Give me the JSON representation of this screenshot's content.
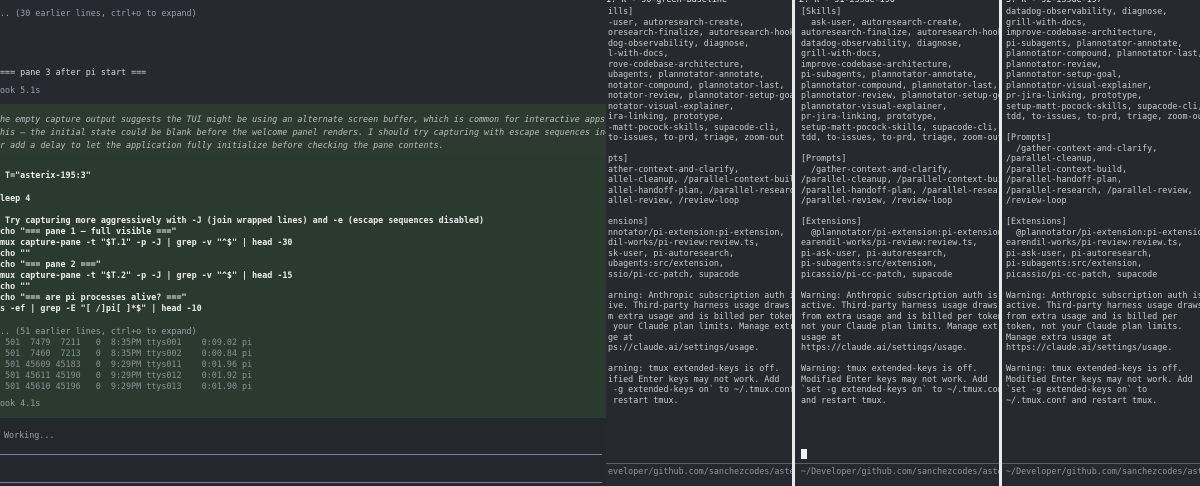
{
  "left": {
    "earlier_lines": ".. (30 earlier lines, ctrl+o to expand)",
    "pane3_after": "=== pane 3 after pi start ===",
    "took1": "ook 5.1s",
    "think1": "he empty capture output suggests the TUI might be using an alternate screen buffer, which is common for interactive apps like",
    "think2": "his — the initial state could be blank before the welcome panel renders. I should try capturing with escape sequences included",
    "think3": "r add a delay to let the application fully initialize before checking the pane contents.",
    "cmd_t": " T=\"asterix-195:3\"",
    "cmd_sleep": "leep 4",
    "cmd_comment": " Try capturing more aggressively with -J (join wrapped lines) and -e (escape sequences disabled)",
    "cmd1": "cho \"=== pane 1 — full visible ===\"",
    "cmd2": "mux capture-pane -t \"$T.1\" -p -J | grep -v \"^$\" | head -30",
    "cmd3": "cho \"\"",
    "cmd4": "cho \"=== pane 2 ===\"",
    "cmd5": "mux capture-pane -t \"$T.2\" -p -J | grep -v \"^$\" | head -15",
    "cmd6": "cho \"\"",
    "cmd7": "cho \"=== are pi processes alive? ===\"",
    "cmd8": "s -ef | grep -E \"[ /]pi[ ]*$\" | head -10",
    "earlier51": ".. (51 earlier lines, ctrl+o to expand)",
    "proc": [
      " 501  7479  7211   0  8:35PM ttys001    0:09.02 pi",
      " 501  7460  7213   0  8:35PM ttys002    0:00.84 pi",
      " 501 45609 45183   0  9:29PM ttys011    0:01.96 pi",
      " 501 45611 45190   0  9:29PM ttys012    0:01.92 pi",
      " 501 45610 45196   0  9:29PM ttys013    0:01.90 pi"
    ],
    "took2": "ook 4.1s",
    "working": "Working..."
  },
  "panes": [
    {
      "title": "1: π - s0-green-baseline",
      "lines": [
        {
          "t": "ills]",
          "c": "hdr"
        },
        {
          "t": "-user, autoresearch-create,",
          "c": ""
        },
        {
          "t": "oresearch-finalize, autoresearch-hooks,",
          "c": ""
        },
        {
          "t": "dog-observability, diagnose,",
          "c": ""
        },
        {
          "t": "l-with-docs,",
          "c": ""
        },
        {
          "t": "rove-codebase-architecture,",
          "c": ""
        },
        {
          "t": "ubagents, plannotator-annotate,",
          "c": ""
        },
        {
          "t": "notator-compound, plannotator-last,",
          "c": ""
        },
        {
          "t": "notator-review, plannotator-setup-goal,",
          "c": ""
        },
        {
          "t": "notator-visual-explainer,",
          "c": ""
        },
        {
          "t": "ira-linking, prototype,",
          "c": ""
        },
        {
          "t": "-matt-pocock-skills, supacode-cli,",
          "c": ""
        },
        {
          "t": "to-issues, to-prd, triage, zoom-out",
          "c": ""
        },
        {
          "t": "",
          "c": ""
        },
        {
          "t": "pts]",
          "c": "hdr"
        },
        {
          "t": "ather-context-and-clarify,",
          "c": ""
        },
        {
          "t": "allel-cleanup, /parallel-context-build,",
          "c": ""
        },
        {
          "t": "allel-handoff-plan, /parallel-research,",
          "c": ""
        },
        {
          "t": "allel-review, /review-loop",
          "c": ""
        },
        {
          "t": "",
          "c": ""
        },
        {
          "t": "ensions]",
          "c": "hdr"
        },
        {
          "t": "nnotator/pi-extension:pi-extension,",
          "c": ""
        },
        {
          "t": "dil-works/pi-review:review.ts,",
          "c": ""
        },
        {
          "t": "sk-user, pi-autoresearch,",
          "c": ""
        },
        {
          "t": "ubagents:src/extension,",
          "c": ""
        },
        {
          "t": "ssio/pi-cc-patch, supacode",
          "c": ""
        },
        {
          "t": "",
          "c": ""
        },
        {
          "t": "arning: Anthropic subscription auth is",
          "c": "warn"
        },
        {
          "t": "ive. Third-party harness usage draws",
          "c": "warn"
        },
        {
          "t": "m extra usage and is billed per token,",
          "c": "warn"
        },
        {
          "t": " your Claude plan limits. Manage extra",
          "c": "warn"
        },
        {
          "t": "ge at",
          "c": "warn"
        },
        {
          "t": "ps://claude.ai/settings/usage.",
          "c": "warn"
        },
        {
          "t": "",
          "c": ""
        },
        {
          "t": "arning: tmux extended-keys is off.",
          "c": "warn"
        },
        {
          "t": "ified Enter keys may not work. Add",
          "c": "warn"
        },
        {
          "t": " -g extended-keys on` to ~/.tmux.conf",
          "c": "warn"
        },
        {
          "t": " restart tmux.",
          "c": "warn"
        }
      ],
      "status1": "eveloper/github.com/sanchezcodes/aste...",
      "status2": "",
      "show_cursor": false
    },
    {
      "title": "2: π - s1-issue-196",
      "lines": [
        {
          "t": "[Skills]",
          "c": "hdr"
        },
        {
          "t": "  ask-user, autoresearch-create,",
          "c": ""
        },
        {
          "t": "autoresearch-finalize, autoresearch-hooks,",
          "c": ""
        },
        {
          "t": "datadog-observability, diagnose,",
          "c": ""
        },
        {
          "t": "grill-with-docs,",
          "c": ""
        },
        {
          "t": "improve-codebase-architecture,",
          "c": ""
        },
        {
          "t": "pi-subagents, plannotator-annotate,",
          "c": ""
        },
        {
          "t": "plannotator-compound, plannotator-last,",
          "c": ""
        },
        {
          "t": "plannotator-review, plannotator-setup-goal,",
          "c": ""
        },
        {
          "t": "plannotator-visual-explainer,",
          "c": ""
        },
        {
          "t": "pr-jira-linking, prototype,",
          "c": ""
        },
        {
          "t": "setup-matt-pocock-skills, supacode-cli,",
          "c": ""
        },
        {
          "t": "tdd, to-issues, to-prd, triage, zoom-out",
          "c": ""
        },
        {
          "t": "",
          "c": ""
        },
        {
          "t": "[Prompts]",
          "c": "hdr"
        },
        {
          "t": "  /gather-context-and-clarify,",
          "c": ""
        },
        {
          "t": "/parallel-cleanup, /parallel-context-build,",
          "c": ""
        },
        {
          "t": "/parallel-handoff-plan, /parallel-research,",
          "c": ""
        },
        {
          "t": "/parallel-review, /review-loop",
          "c": ""
        },
        {
          "t": "",
          "c": ""
        },
        {
          "t": "[Extensions]",
          "c": "hdr"
        },
        {
          "t": "  @plannotator/pi-extension:pi-extension,",
          "c": ""
        },
        {
          "t": "earendil-works/pi-review:review.ts,",
          "c": ""
        },
        {
          "t": "pi-ask-user, pi-autoresearch,",
          "c": ""
        },
        {
          "t": "pi-subagents:src/extension,",
          "c": ""
        },
        {
          "t": "picassio/pi-cc-patch, supacode",
          "c": ""
        },
        {
          "t": "",
          "c": ""
        },
        {
          "t": "Warning: Anthropic subscription auth is",
          "c": "warn"
        },
        {
          "t": "active. Third-party harness usage draws",
          "c": "warn"
        },
        {
          "t": "from extra usage and is billed per token,",
          "c": "warn"
        },
        {
          "t": "not your Claude plan limits. Manage extra",
          "c": "warn"
        },
        {
          "t": "usage at",
          "c": "warn"
        },
        {
          "t": "https://claude.ai/settings/usage.",
          "c": "warn"
        },
        {
          "t": "",
          "c": ""
        },
        {
          "t": "Warning: tmux extended-keys is off.",
          "c": "warn"
        },
        {
          "t": "Modified Enter keys may not work. Add",
          "c": "warn"
        },
        {
          "t": "`set -g extended-keys on` to ~/.tmux.conf",
          "c": "warn"
        },
        {
          "t": "and restart tmux.",
          "c": "warn"
        }
      ],
      "status1": "~/Developer/github.com/sanchezcodes/aste...",
      "status2": "",
      "show_cursor": true
    },
    {
      "title": "3: π - s2-issue-197",
      "lines": [
        {
          "t": "datadog-observability, diagnose,",
          "c": ""
        },
        {
          "t": "grill-with-docs,",
          "c": ""
        },
        {
          "t": "improve-codebase-architecture,",
          "c": ""
        },
        {
          "t": "pi-subagents, plannotator-annotate,",
          "c": ""
        },
        {
          "t": "plannotator-compound, plannotator-last,",
          "c": ""
        },
        {
          "t": "plannotator-review,",
          "c": ""
        },
        {
          "t": "plannotator-setup-goal,",
          "c": ""
        },
        {
          "t": "plannotator-visual-explainer,",
          "c": ""
        },
        {
          "t": "pr-jira-linking, prototype,",
          "c": ""
        },
        {
          "t": "setup-matt-pocock-skills, supacode-cli,",
          "c": ""
        },
        {
          "t": "tdd, to-issues, to-prd, triage, zoom-out",
          "c": ""
        },
        {
          "t": "",
          "c": ""
        },
        {
          "t": "[Prompts]",
          "c": "hdr"
        },
        {
          "t": "  /gather-context-and-clarify,",
          "c": ""
        },
        {
          "t": "/parallel-cleanup,",
          "c": ""
        },
        {
          "t": "/parallel-context-build,",
          "c": ""
        },
        {
          "t": "/parallel-handoff-plan,",
          "c": ""
        },
        {
          "t": "/parallel-research, /parallel-review,",
          "c": ""
        },
        {
          "t": "/review-loop",
          "c": ""
        },
        {
          "t": "",
          "c": ""
        },
        {
          "t": "[Extensions]",
          "c": "hdr"
        },
        {
          "t": "  @plannotator/pi-extension:pi-extension,",
          "c": ""
        },
        {
          "t": "earendil-works/pi-review:review.ts,",
          "c": ""
        },
        {
          "t": "pi-ask-user, pi-autoresearch,",
          "c": ""
        },
        {
          "t": "pi-subagents:src/extension,",
          "c": ""
        },
        {
          "t": "picassio/pi-cc-patch, supacode",
          "c": ""
        },
        {
          "t": "",
          "c": ""
        },
        {
          "t": "Warning: Anthropic subscription auth is",
          "c": "warn"
        },
        {
          "t": "active. Third-party harness usage draws",
          "c": "warn"
        },
        {
          "t": "from extra usage and is billed per",
          "c": "warn"
        },
        {
          "t": "token, not your Claude plan limits.",
          "c": "warn"
        },
        {
          "t": "Manage extra usage at",
          "c": "warn"
        },
        {
          "t": "https://claude.ai/settings/usage.",
          "c": "warn"
        },
        {
          "t": "",
          "c": ""
        },
        {
          "t": "Warning: tmux extended-keys is off.",
          "c": "warn"
        },
        {
          "t": "Modified Enter keys may not work. Add",
          "c": "warn"
        },
        {
          "t": "`set -g extended-keys on` to",
          "c": "warn"
        },
        {
          "t": "~/.tmux.conf and restart tmux.",
          "c": "warn"
        }
      ],
      "status1": "~/Developer/github.com/sanchezcodes/aste...",
      "status2": "",
      "show_cursor": false
    }
  ],
  "colors": {
    "header": "#e0a35a",
    "warning": "#f0c27a",
    "rule": "#8a7aa6"
  }
}
